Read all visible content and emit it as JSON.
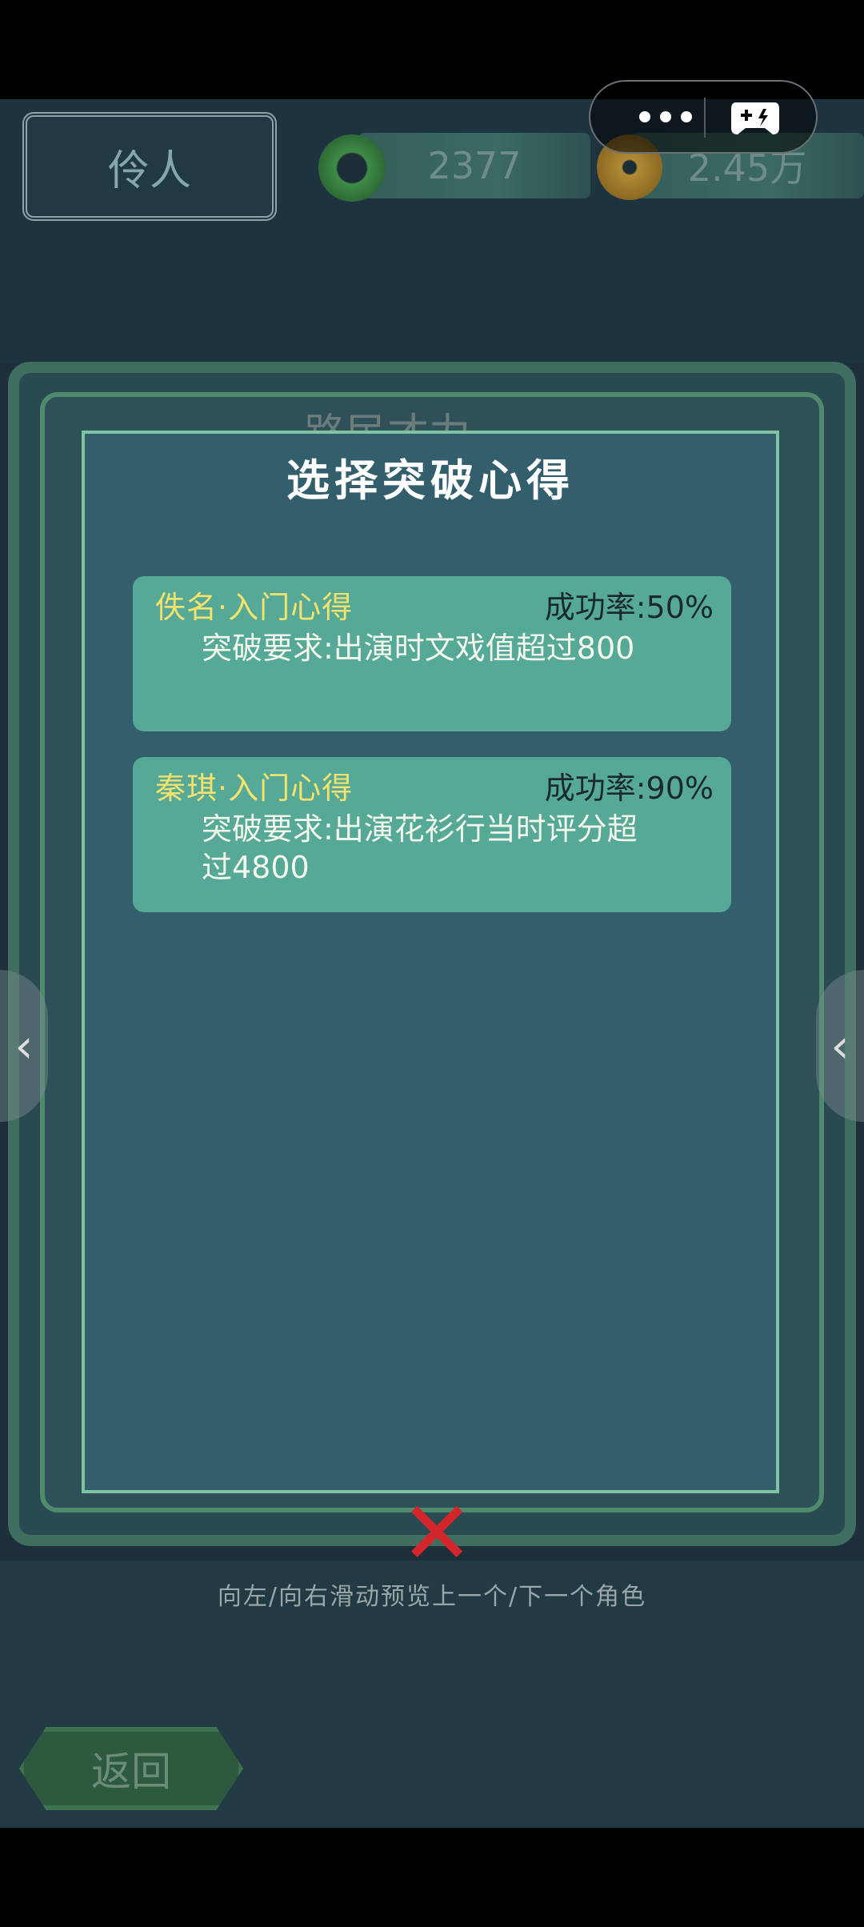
{
  "top_bar": {
    "player_name": "伶人",
    "jade_amount": "2377",
    "coin_amount": "2.45万"
  },
  "capsule": {
    "more_icon": "dots-icon",
    "game_icon": "gamepad-icon"
  },
  "background": {
    "panel_title": "路民才力",
    "hint": "向左/向右滑动预览上一个/下一个角色",
    "back_label": "返回"
  },
  "modal": {
    "title": "选择突破心得",
    "cards": [
      {
        "name": "佚名·入门心得",
        "rate": "成功率:50%",
        "requirement": "突破要求:出演时文戏值超过800"
      },
      {
        "name": "秦琪·入门心得",
        "rate": "成功率:90%",
        "requirement": "突破要求:出演花衫行当时评分超过4800"
      }
    ],
    "close_icon": "close-x-icon"
  },
  "colors": {
    "modal_bg": "#335e6b",
    "card_bg": "#56a997",
    "card_name": "#f3e26d",
    "close": "#d3262c"
  }
}
